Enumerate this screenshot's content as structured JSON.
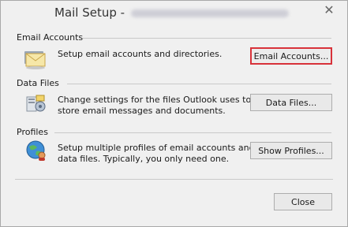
{
  "window": {
    "title": "Mail Setup -",
    "close_glyph": "✕"
  },
  "sections": {
    "email_accounts": {
      "label": "Email Accounts",
      "description": "Setup email accounts and directories.",
      "button_label": "Email Accounts...",
      "icon": "envelope-icon"
    },
    "data_files": {
      "label": "Data Files",
      "description_line1": "Change settings for the files Outlook uses to",
      "description_line2": "store email messages and documents.",
      "button_label": "Data Files...",
      "icon": "data-files-icon"
    },
    "profiles": {
      "label": "Profiles",
      "description_line1": "Setup multiple profiles of email accounts and",
      "description_line2": "data files. Typically, you only need one.",
      "button_label": "Show Profiles...",
      "icon": "profiles-globe-icon"
    }
  },
  "footer": {
    "close_label": "Close"
  },
  "colors": {
    "highlight_border": "#d8323a",
    "background": "#f0f0f0"
  }
}
